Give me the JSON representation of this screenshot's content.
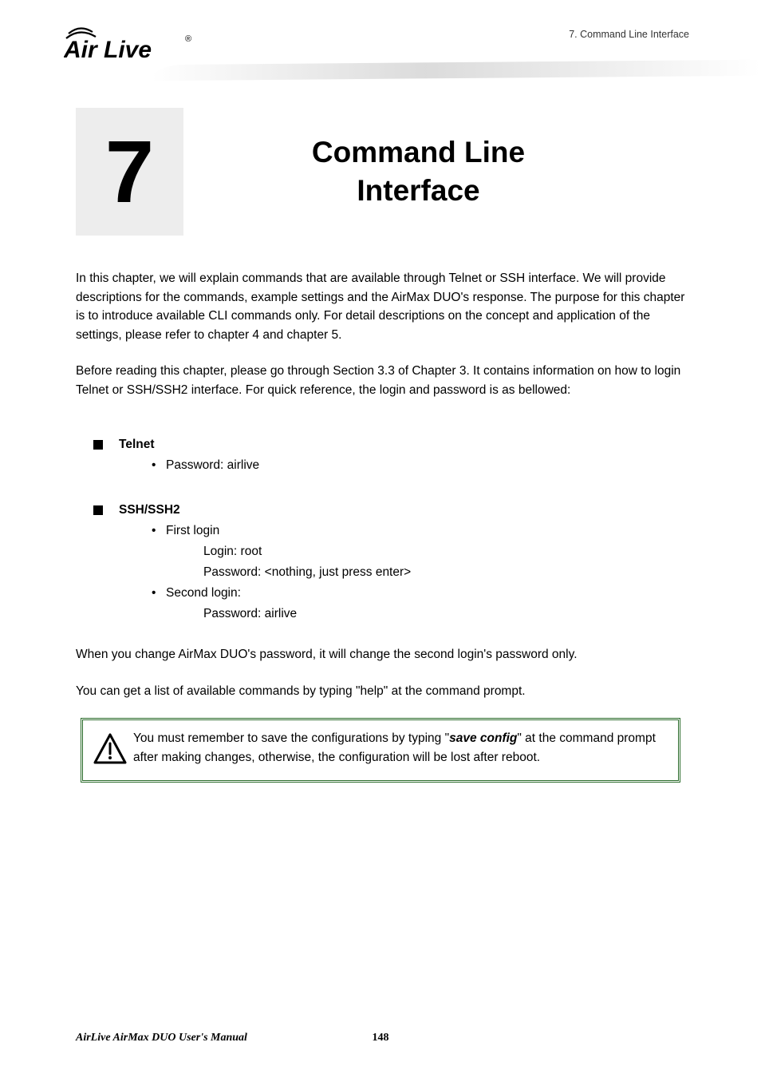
{
  "header": {
    "logo_text": "Air Live",
    "breadcrumb": "7. Command Line Interface"
  },
  "title": {
    "number": "7",
    "heading_line1": "Command Line",
    "heading_line2": "Interface"
  },
  "paragraphs": {
    "intro": "In this chapter, we will explain commands that are available through Telnet or SSH interface. We will provide descriptions for the commands, example settings and the AirMax DUO's response. The purpose for this chapter is to introduce available CLI commands only. For detail descriptions on the concept and application of the settings, please refer to chapter 4 and chapter 5.",
    "before": "Before reading this chapter, please go through Section 3.3 of Chapter 3. It contains information on how to login Telnet or SSH/SSH2 interface. For quick reference, the login and password is as bellowed:"
  },
  "telnet": {
    "heading": "Telnet",
    "password_label": "Password: airlive"
  },
  "ssh": {
    "heading": "SSH/SSH2",
    "first_login": "First login",
    "login_root": "Login: root",
    "password_nothing": "Password: <nothing, just press enter>",
    "second_login": "Second login:",
    "password_airlive": "Password: airlive"
  },
  "after": {
    "p1": "When you change AirMax DUO's password, it will change the second login's password only.",
    "p2": "You can get a list of available commands by typing \"help\" at the command prompt."
  },
  "callout": {
    "pre": "You must remember to save the configurations by typing \"",
    "bold1": "save config",
    "post": "\" at the command prompt after making changes, otherwise, the configuration will be lost after reboot."
  },
  "footer": {
    "manual": "AirLive AirMax DUO User's Manual",
    "page": "148"
  }
}
